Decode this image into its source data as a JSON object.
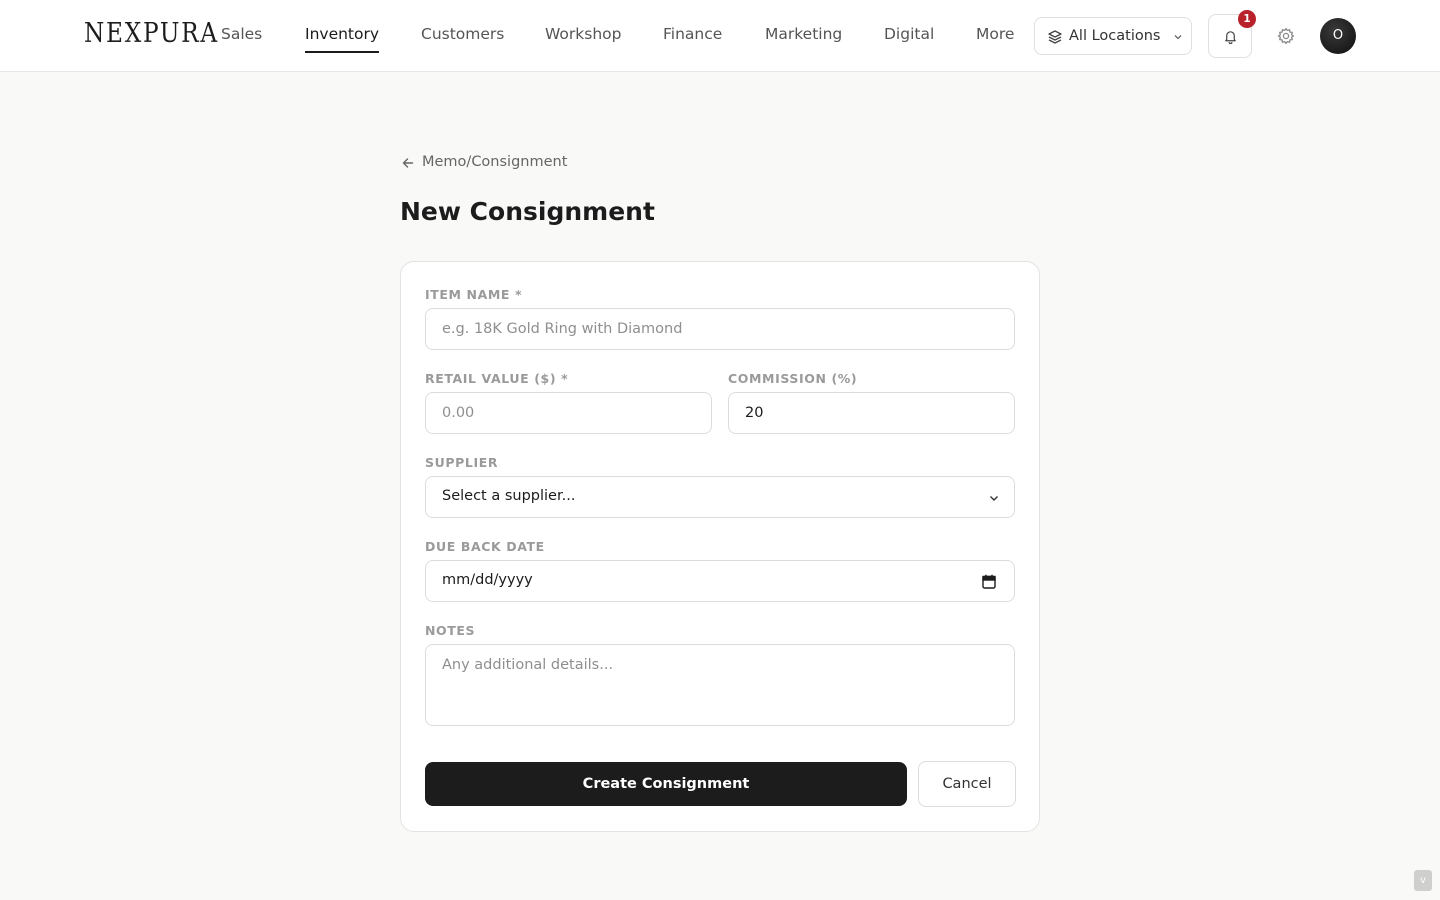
{
  "brand": {
    "logo_text": "NEXPURA"
  },
  "nav": {
    "items": [
      {
        "label": "Sales",
        "active": false
      },
      {
        "label": "Inventory",
        "active": true
      },
      {
        "label": "Customers",
        "active": false
      },
      {
        "label": "Workshop",
        "active": false
      },
      {
        "label": "Finance",
        "active": false
      },
      {
        "label": "Marketing",
        "active": false
      },
      {
        "label": "Digital",
        "active": false
      },
      {
        "label": "More",
        "active": false
      }
    ],
    "location_select": {
      "value": "All Locations",
      "icon": "layers-icon"
    },
    "notifications": {
      "count": "1",
      "icon": "bell-icon"
    },
    "settings_icon": "gear-icon",
    "avatar_initial": "O"
  },
  "page": {
    "back_link_label": "Memo/Consignment",
    "title": "New Consignment"
  },
  "form": {
    "item_name": {
      "label": "ITEM NAME *",
      "placeholder": "e.g. 18K Gold Ring with Diamond",
      "value": ""
    },
    "retail_value": {
      "label": "RETAIL VALUE ($) *",
      "placeholder": "0.00",
      "value": ""
    },
    "commission": {
      "label": "COMMISSION (%)",
      "value": "20"
    },
    "supplier": {
      "label": "SUPPLIER",
      "selected": "Select a supplier..."
    },
    "due_back_date": {
      "label": "DUE BACK DATE",
      "placeholder": "mm/dd/yyyy"
    },
    "notes": {
      "label": "NOTES",
      "placeholder": "Any additional details..."
    },
    "submit_label": "Create Consignment",
    "cancel_label": "Cancel"
  },
  "colors": {
    "primary_button": "#1c1c1c",
    "badge": "#b9212b",
    "page_background": "#f9f9f8"
  }
}
